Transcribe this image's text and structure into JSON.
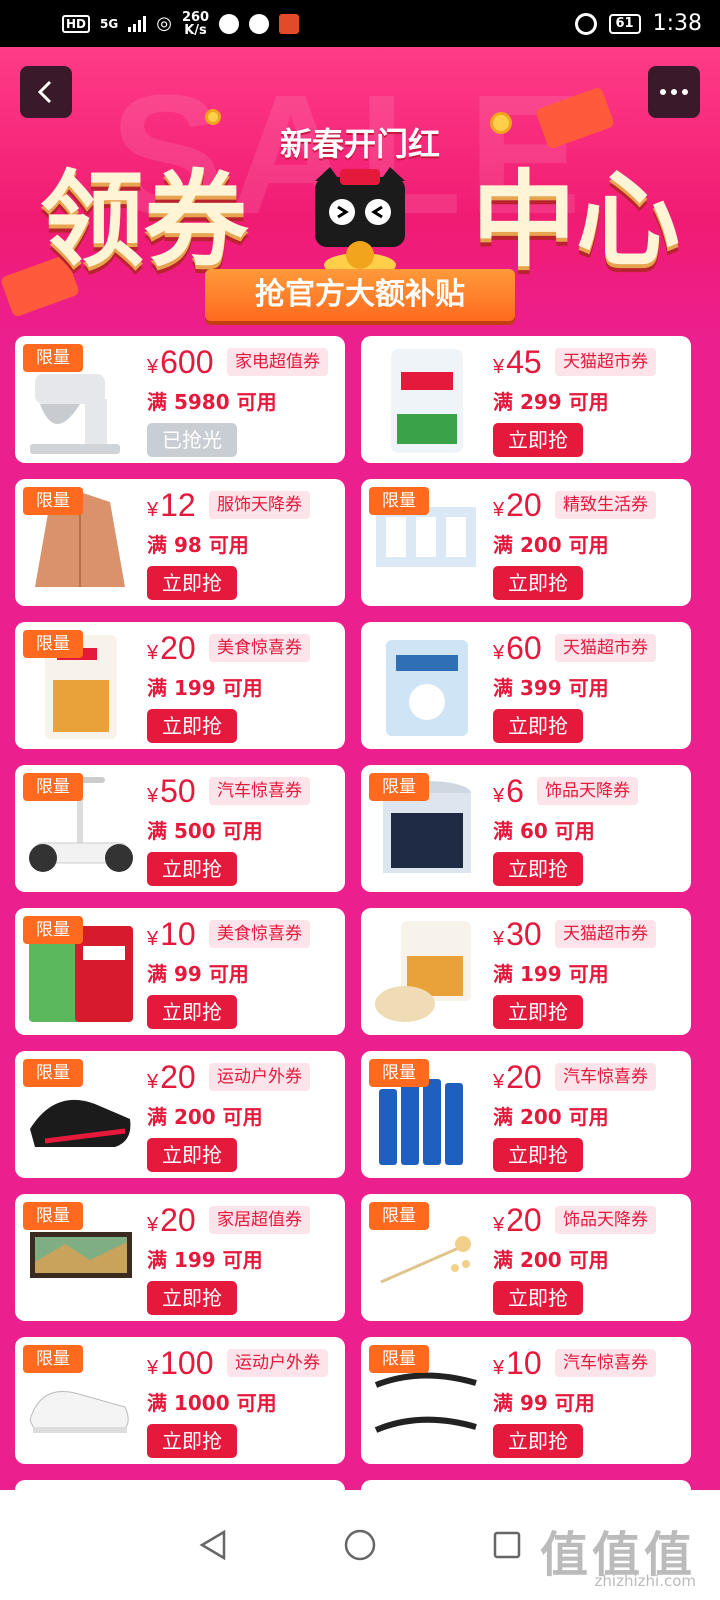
{
  "status_bar": {
    "network": "HD",
    "signal": "5G",
    "speed_value": "260",
    "speed_unit": "K/s",
    "battery": "61",
    "time": "1:38"
  },
  "header": {
    "bg_word": "SALE",
    "subtitle": "新春开门红",
    "title_left": "领券",
    "title_right": "中心",
    "banner": "抢官方大额补贴"
  },
  "coupons": [
    {
      "badge": "限量",
      "amount": "600",
      "category": "家电超值券",
      "condition": "满 5980 可用",
      "button": "已抢光",
      "sold_out": true,
      "img": "mixer"
    },
    {
      "badge": "",
      "amount": "45",
      "category": "天猫超市券",
      "condition": "满 299 可用",
      "button": "立即抢",
      "sold_out": false,
      "img": "flour"
    },
    {
      "badge": "限量",
      "amount": "12",
      "category": "服饰天降券",
      "condition": "满 98 可用",
      "button": "立即抢",
      "sold_out": false,
      "img": "jacket"
    },
    {
      "badge": "限量",
      "amount": "20",
      "category": "精致生活券",
      "condition": "满 200 可用",
      "button": "立即抢",
      "sold_out": false,
      "img": "tissue"
    },
    {
      "badge": "限量",
      "amount": "20",
      "category": "美食惊喜券",
      "condition": "满 199 可用",
      "button": "立即抢",
      "sold_out": false,
      "img": "wheat"
    },
    {
      "badge": "",
      "amount": "60",
      "category": "天猫超市券",
      "condition": "满 399 可用",
      "button": "立即抢",
      "sold_out": false,
      "img": "bag"
    },
    {
      "badge": "限量",
      "amount": "50",
      "category": "汽车惊喜券",
      "condition": "满 500 可用",
      "button": "立即抢",
      "sold_out": false,
      "img": "scooter"
    },
    {
      "badge": "限量",
      "amount": "6",
      "category": "饰品天降券",
      "condition": "满 60 可用",
      "button": "立即抢",
      "sold_out": false,
      "img": "jar"
    },
    {
      "badge": "限量",
      "amount": "10",
      "category": "美食惊喜券",
      "condition": "满 99 可用",
      "button": "立即抢",
      "sold_out": false,
      "img": "sugar"
    },
    {
      "badge": "",
      "amount": "30",
      "category": "天猫超市券",
      "condition": "满 199 可用",
      "button": "立即抢",
      "sold_out": false,
      "img": "dumpling"
    },
    {
      "badge": "限量",
      "amount": "20",
      "category": "运动户外券",
      "condition": "满 200 可用",
      "button": "立即抢",
      "sold_out": false,
      "img": "shoe"
    },
    {
      "badge": "限量",
      "amount": "20",
      "category": "汽车惊喜券",
      "condition": "满 200 可用",
      "button": "立即抢",
      "sold_out": false,
      "img": "bottles"
    },
    {
      "badge": "限量",
      "amount": "20",
      "category": "家居超值券",
      "condition": "满 199 可用",
      "button": "立即抢",
      "sold_out": false,
      "img": "painting"
    },
    {
      "badge": "限量",
      "amount": "20",
      "category": "饰品天降券",
      "condition": "满 200 可用",
      "button": "立即抢",
      "sold_out": false,
      "img": "hairpin"
    },
    {
      "badge": "限量",
      "amount": "100",
      "category": "运动户外券",
      "condition": "满 1000 可用",
      "button": "立即抢",
      "sold_out": false,
      "img": "sneaker"
    },
    {
      "badge": "限量",
      "amount": "10",
      "category": "汽车惊喜券",
      "condition": "满 99 可用",
      "button": "立即抢",
      "sold_out": false,
      "img": "wiper"
    }
  ],
  "currency": "¥",
  "watermark": {
    "logo": "值值值",
    "url": "zhizhizhi.com"
  },
  "colors": {
    "accent": "#e5193c",
    "bg": "#ec1f8f",
    "badge": "#ff6a1f"
  }
}
